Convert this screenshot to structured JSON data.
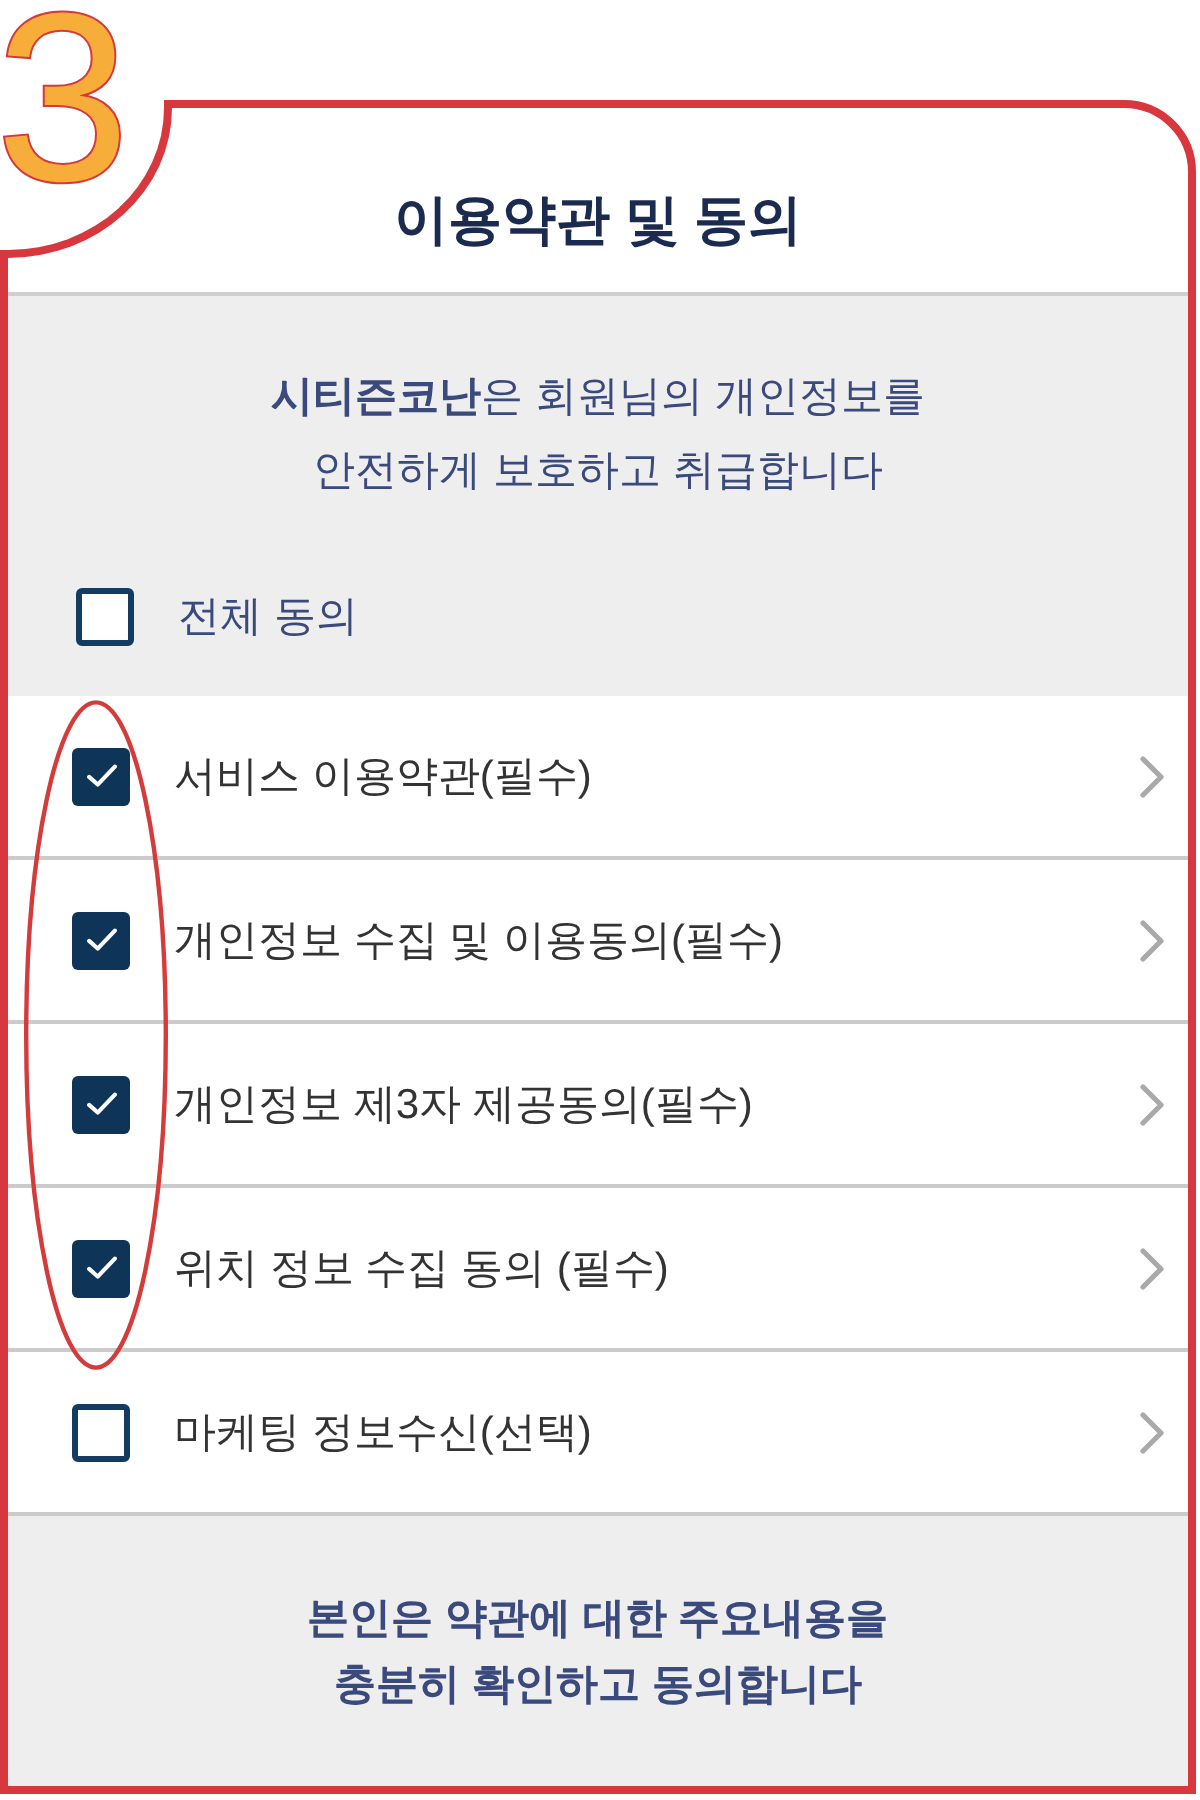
{
  "step": "3",
  "title": "이용약관 및 동의",
  "intro": {
    "lines": [
      "**시티즌코난**은 회원님의 개인정보를",
      "안전하게 보호하고 취급합니다"
    ]
  },
  "agree_all": {
    "label": "전체 동의",
    "checked": false
  },
  "terms": [
    {
      "label": "서비스 이용약관(필수)",
      "checked": true
    },
    {
      "label": "개인정보 수집 및 이용동의(필수)",
      "checked": true
    },
    {
      "label": "개인정보 제3자 제공동의(필수)",
      "checked": true
    },
    {
      "label": "위치 정보 수집 동의 (필수)",
      "checked": true
    },
    {
      "label": "마케팅 정보수신(선택)",
      "checked": false
    }
  ],
  "footer": {
    "lines": [
      "본인은 약관에 대한 주요내용을",
      "충분히 확인하고 동의합니다"
    ]
  }
}
